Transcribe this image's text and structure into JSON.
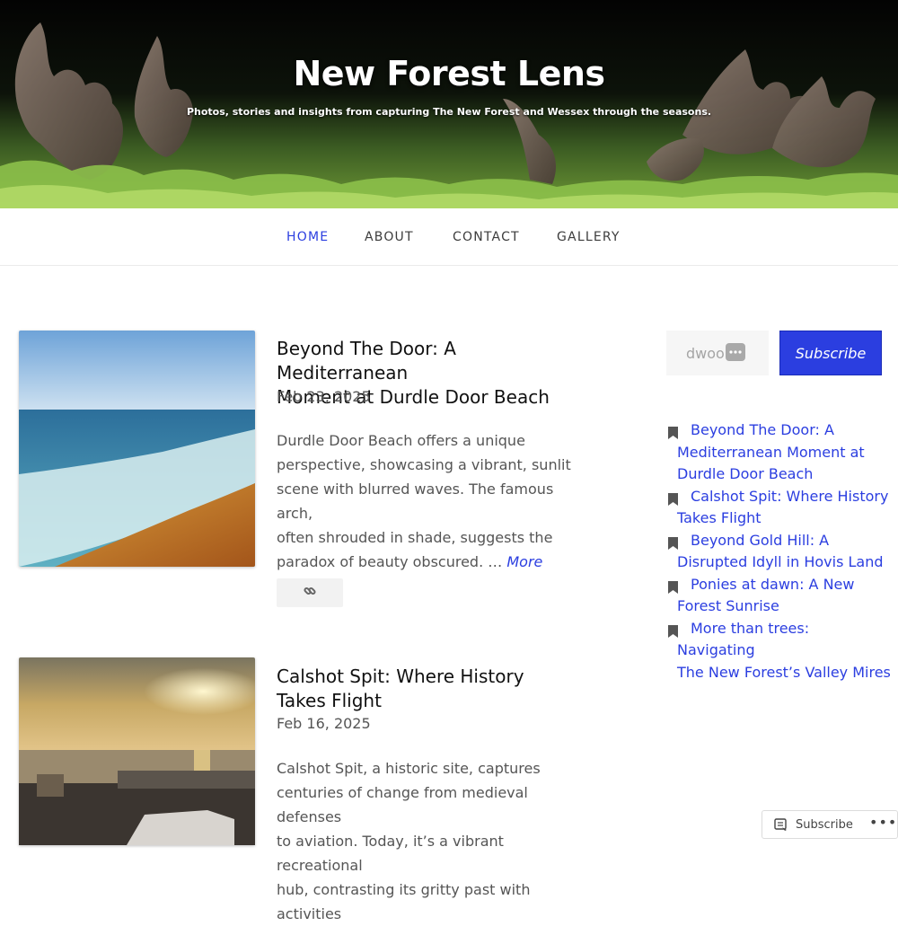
{
  "site": {
    "title": "New Forest Lens",
    "tagline": "Photos, stories and insights from capturing The New Forest and Wessex through the seasons."
  },
  "nav": {
    "items": [
      {
        "label": "HOME",
        "active": true
      },
      {
        "label": "ABOUT",
        "active": false
      },
      {
        "label": "CONTACT",
        "active": false
      },
      {
        "label": "GALLERY",
        "active": false
      }
    ]
  },
  "posts": [
    {
      "title_lines": [
        "Beyond The Door: A Mediterranean",
        "Moment at Durdle Door Beach"
      ],
      "date": "Feb 23, 2025",
      "excerpt_lines": [
        "Durdle Door Beach offers a unique",
        "perspective, showcasing a vibrant, sunlit",
        "scene with blurred waves. The famous arch,",
        "often shrouded in shade, suggests the",
        "paradox of beauty obscured. … "
      ],
      "more_label": "More"
    },
    {
      "title_lines": [
        "Calshot Spit: Where History",
        "Takes Flight"
      ],
      "date": "Feb 16, 2025",
      "excerpt_lines": [
        "Calshot Spit, a historic site, captures",
        "centuries of change from medieval defenses",
        "to aviation. Today, it’s a vibrant recreational",
        "hub, contrasting its gritty past with activities"
      ]
    }
  ],
  "sidebar": {
    "email_placeholder": "dwoo",
    "subscribe_label": "Subscribe",
    "recent_posts": [
      [
        "Beyond The Door: A",
        "Mediterranean Moment at",
        "Durdle Door Beach"
      ],
      [
        "Calshot Spit: Where History",
        "Takes Flight"
      ],
      [
        "Beyond Gold Hill: A",
        "Disrupted Idyll in Hovis Land"
      ],
      [
        "Ponies at dawn: A New",
        "Forest Sunrise"
      ],
      [
        "More than trees: Navigating",
        "The New Forest’s Valley Mires"
      ]
    ]
  },
  "follow_bar": {
    "subscribe_label": "Subscribe",
    "more_icon": "ellipsis-icon"
  },
  "colors": {
    "accent": "#2b3ee0",
    "text": "#333333",
    "muted": "#555555"
  }
}
